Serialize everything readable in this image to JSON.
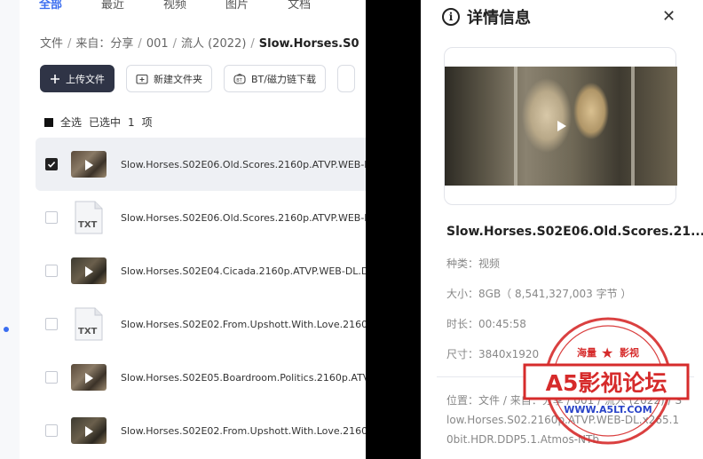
{
  "tabs": [
    "全部",
    "最近",
    "视频",
    "图片",
    "文档"
  ],
  "breadcrumb": {
    "items": [
      "文件",
      "来自：分享",
      "001",
      "流人 (2022)"
    ],
    "current": "Slow.Horses.S0"
  },
  "toolbar": {
    "upload_label": "上传文件",
    "new_folder_label": "新建文件夹",
    "bt_label": "BT/磁力链下载"
  },
  "selection": {
    "select_all_label": "全选",
    "selected_label": "已选中",
    "count": "1",
    "unit": "项"
  },
  "files": [
    {
      "name": "Slow.Horses.S02E06.Old.Scores.2160p.ATVP.WEB-D",
      "kind": "video",
      "selected": true
    },
    {
      "name": "Slow.Horses.S02E06.Old.Scores.2160p.ATVP.WEB-D",
      "kind": "txt",
      "selected": false
    },
    {
      "name": "Slow.Horses.S02E04.Cicada.2160p.ATVP.WEB-DL.D",
      "kind": "video",
      "selected": false
    },
    {
      "name": "Slow.Horses.S02E02.From.Upshott.With.Love.2160",
      "kind": "txt",
      "selected": false
    },
    {
      "name": "Slow.Horses.S02E05.Boardroom.Politics.2160p.ATV",
      "kind": "video",
      "selected": false
    },
    {
      "name": "Slow.Horses.S02E02.From.Upshott.With.Love.2160",
      "kind": "video",
      "selected": false
    }
  ],
  "txt_label": "TXT",
  "panel": {
    "title": "详情信息",
    "close_glyph": "✕",
    "file_name": "Slow.Horses.S02E06.Old.Scores.21...",
    "type_label": "种类：",
    "type_value": "视频",
    "size_label": "大小：",
    "size_value": "8GB（ 8,541,327,003 字节 ）",
    "duration_label": "时长：",
    "duration_value": "00:45:58",
    "dimension_label": "尺寸：",
    "dimension_value": "3840x1920",
    "location_label": "位置：",
    "location_value": "文件 / 来自：分享 / 001 / 流人 (2022) / Slow.Horses.S02.2160p.ATVP.WEB-DL.x265.10bit.HDR.DDP5.1.Atmos-NTb"
  },
  "stamp": {
    "top_left": "海量",
    "top_right": "影视",
    "brand": "A5影视论坛",
    "url": "WWW.A5LT.COM"
  },
  "colors": {
    "accent": "#3a6df0",
    "primary_button": "#2f3446",
    "stamp_red": "#d62b2b"
  }
}
